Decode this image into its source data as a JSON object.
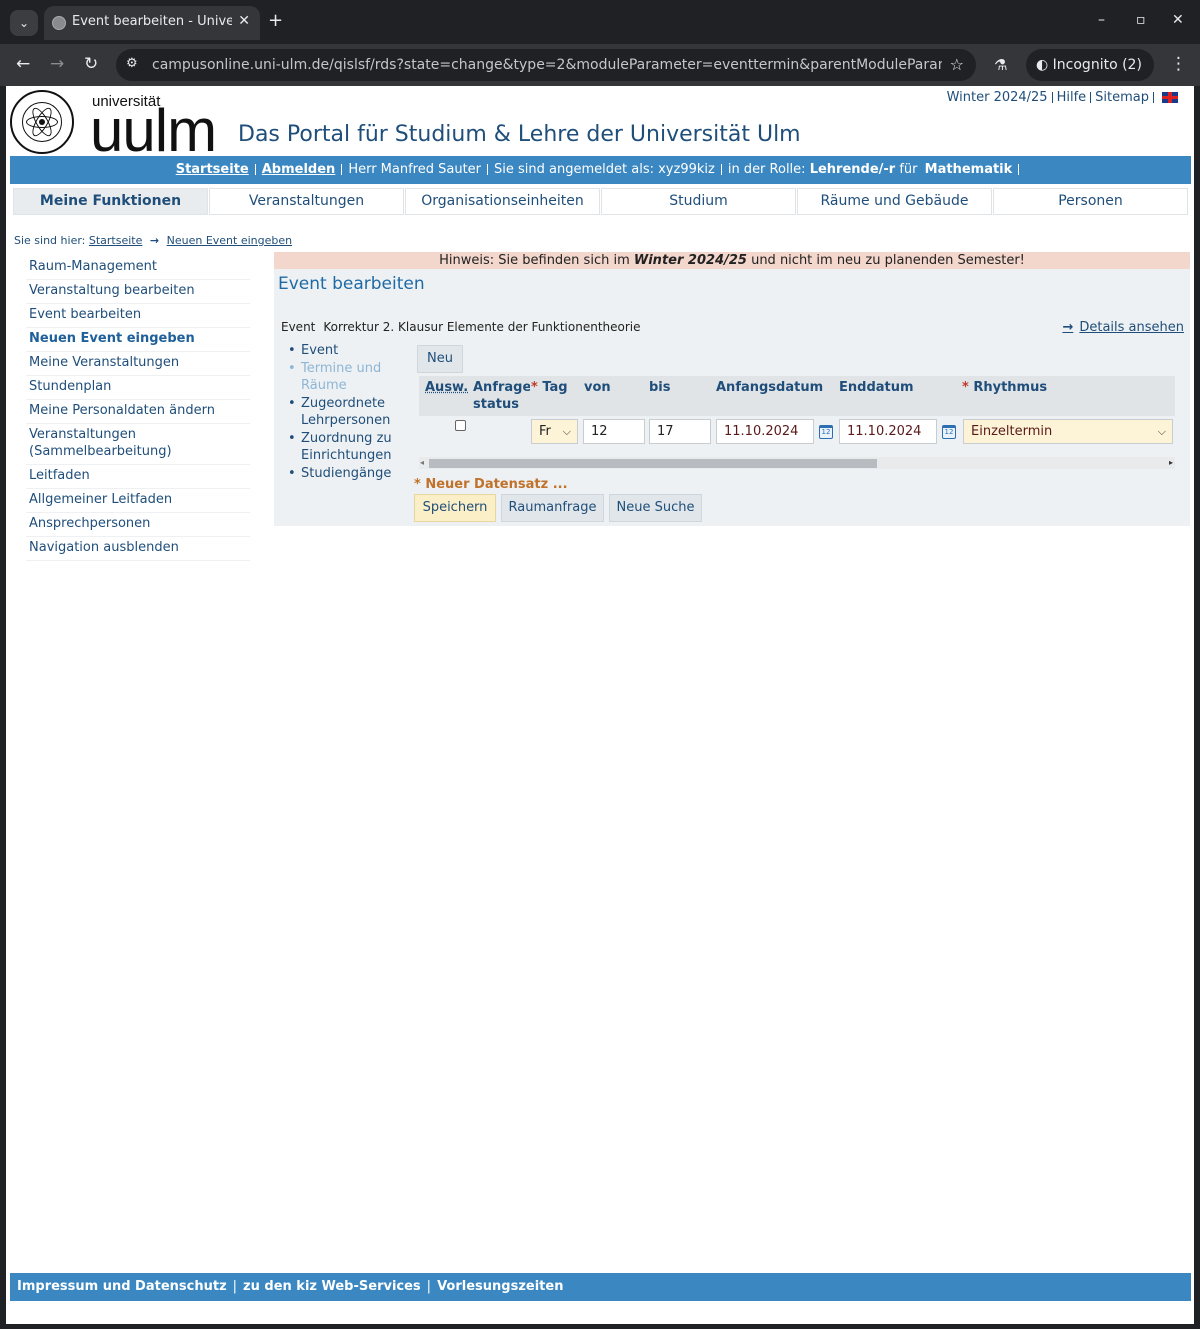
{
  "browser": {
    "tab_title": "Event bearbeiten - Univer",
    "url": "campusonline.uni-ulm.de/qislsf/rds?state=change&type=2&moduleParameter=eventtermin&parentModuleParamete...",
    "incognito_label": "Incognito (2)"
  },
  "header": {
    "wordmark_small": "universität",
    "wordmark_big": "uulm",
    "portal_title": "Das Portal für Studium & Lehre der Universität Ulm",
    "semester_link": "Winter 2024/25",
    "help_link": "Hilfe",
    "sitemap_link": "Sitemap"
  },
  "userbar": {
    "home": "Startseite",
    "logout": "Abmelden",
    "user_name": "Herr Manfred Sauter",
    "logged_in_as": "Sie sind angemeldet als: xyz99kiz",
    "role_prefix": "in der Rolle:",
    "role": "Lehrende/-r",
    "for_word": "für",
    "department": "Mathematik"
  },
  "mainnav": [
    {
      "label": "Meine Funktionen"
    },
    {
      "label": "Veranstaltungen"
    },
    {
      "label": "Organisationseinheiten"
    },
    {
      "label": "Studium"
    },
    {
      "label": "Räume und Gebäude"
    },
    {
      "label": "Personen"
    }
  ],
  "breadcrumb": {
    "prefix": "Sie sind hier:",
    "home": "Startseite",
    "current": "Neuen Event eingeben"
  },
  "sidenav": [
    {
      "label": "Raum-Management"
    },
    {
      "label": "Veranstaltung bearbeiten"
    },
    {
      "label": "Event bearbeiten"
    },
    {
      "label": "Neuen Event eingeben"
    },
    {
      "label": "Meine Veranstaltungen"
    },
    {
      "label": "Stundenplan"
    },
    {
      "label": "Meine Personaldaten ändern"
    },
    {
      "label": "Veranstaltungen (Sammelbearbeitung)"
    },
    {
      "label": "Leitfaden"
    },
    {
      "label": "Allgemeiner Leitfaden"
    },
    {
      "label": "Ansprechpersonen"
    },
    {
      "label": "Navigation ausblenden"
    }
  ],
  "notice": {
    "before": "Hinweis: Sie befinden sich im",
    "semester": "Winter 2024/25",
    "after": "und nicht im neu zu planenden Semester!"
  },
  "main": {
    "title": "Event bearbeiten",
    "event_label": "Event",
    "event_name": "Korrektur 2. Klausur Elemente der Funktionentheorie",
    "details_link": "Details ansehen",
    "subnav": [
      {
        "label": "Event"
      },
      {
        "label": "Termine und Räume"
      },
      {
        "label": "Zugeordnete Lehrpersonen"
      },
      {
        "label": "Zuordnung zu Einrichtungen"
      },
      {
        "label": "Studiengänge"
      }
    ],
    "new_button": "Neu",
    "columns": {
      "ausw": "Ausw.",
      "status": "Anfrage-status",
      "tag": "Tag",
      "von": "von",
      "bis": "bis",
      "anfangsdatum": "Anfangsdatum",
      "enddatum": "Enddatum",
      "rhythmus": "Rhythmus"
    },
    "required_marker": "*",
    "row": {
      "tag": "Fr",
      "von": "12",
      "bis": "17",
      "anfangsdatum": "11.10.2024",
      "enddatum": "11.10.2024",
      "rhythmus": "Einzeltermin"
    },
    "calendar_day": "12",
    "new_record": "* Neuer Datensatz ...",
    "buttons": {
      "save": "Speichern",
      "room_request": "Raumanfrage",
      "new_search": "Neue Suche"
    }
  },
  "footer": {
    "imprint": "Impressum und Datenschutz",
    "kiz": "zu den kiz Web-Services",
    "lectures": "Vorlesungszeiten"
  }
}
